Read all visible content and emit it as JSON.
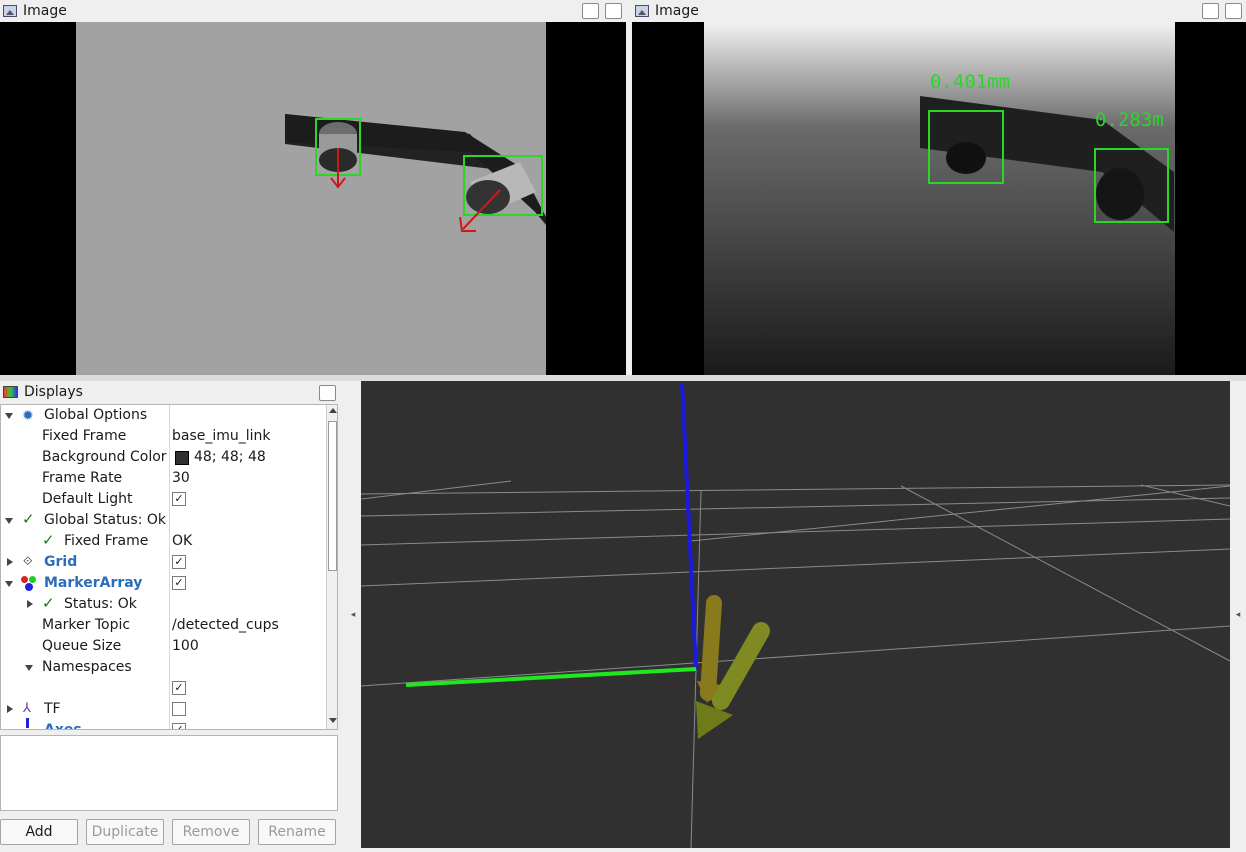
{
  "image_panel_left": {
    "title": "Image"
  },
  "image_panel_right": {
    "title": "Image",
    "labels": [
      "0.401mm",
      "0.283m"
    ]
  },
  "displays": {
    "title": "Displays",
    "rows": [
      {
        "label": "Global Options"
      },
      {
        "label": "Fixed Frame",
        "value": "base_imu_link"
      },
      {
        "label": "Background Color",
        "value": "48; 48; 48"
      },
      {
        "label": "Frame Rate",
        "value": "30"
      },
      {
        "label": "Default Light"
      },
      {
        "label": "Global Status: Ok"
      },
      {
        "label": "Fixed Frame",
        "value": "OK"
      },
      {
        "label": "Grid"
      },
      {
        "label": "MarkerArray"
      },
      {
        "label": "Status: Ok"
      },
      {
        "label": "Marker Topic",
        "value": "/detected_cups"
      },
      {
        "label": "Queue Size",
        "value": "100"
      },
      {
        "label": "Namespaces"
      },
      {
        "label": ""
      },
      {
        "label": "TF"
      },
      {
        "label": "Axes"
      }
    ],
    "checks": [
      "✓",
      "✓",
      "✓",
      "✓",
      "",
      "✓"
    ]
  },
  "buttons": {
    "add": "Add",
    "duplicate": "Duplicate",
    "remove": "Remove",
    "rename": "Rename"
  },
  "colors": {
    "background": "#303030",
    "detection_box": "#2bd62b",
    "arrow": "#cc1a1a",
    "axis_x": "#1fe81f",
    "axis_z": "#1a1ae0",
    "marker": "#8a8c22"
  },
  "icons": [
    "image-icon",
    "monitor-icon",
    "gear-icon",
    "grid-icon",
    "marker-array-icon",
    "tf-icon",
    "axes-icon",
    "check-icon"
  ]
}
